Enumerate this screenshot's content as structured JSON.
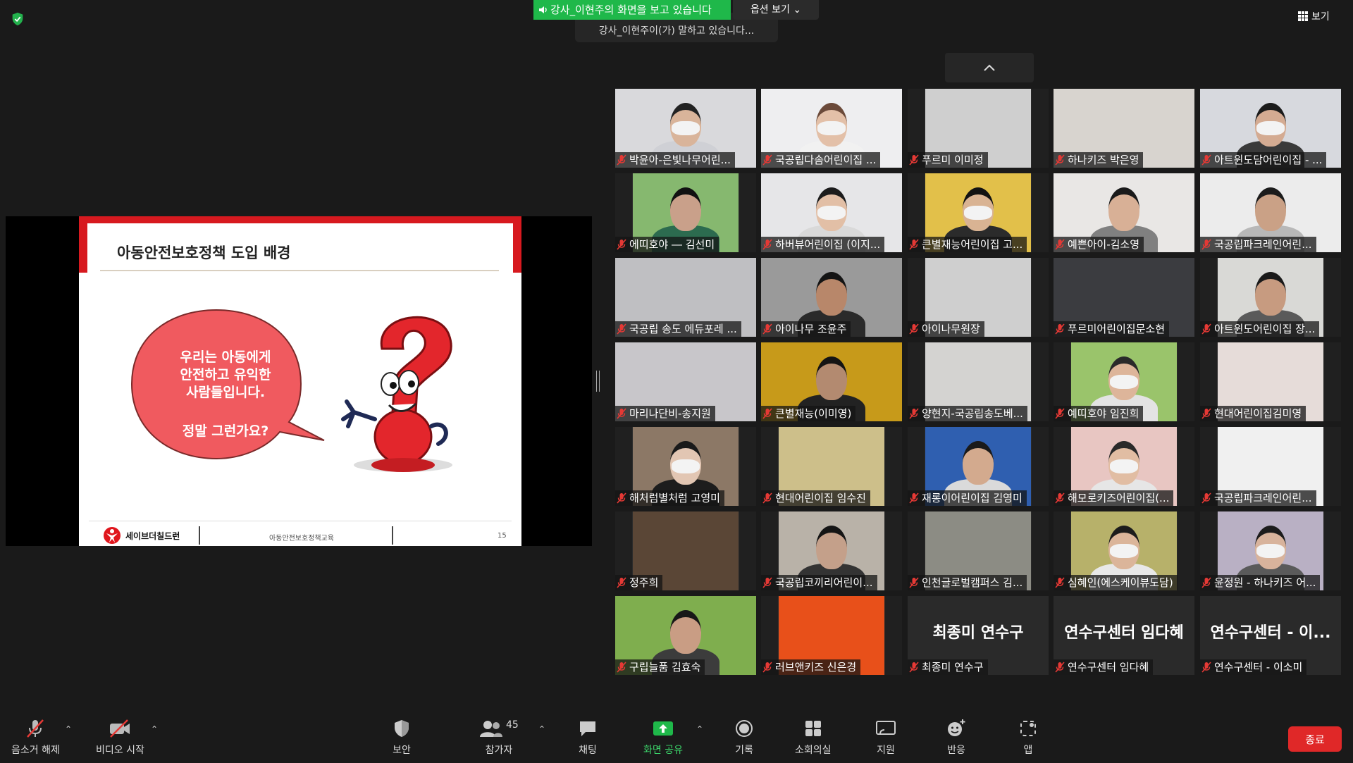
{
  "top": {
    "share_banner": "강사_이현주의 화면을 보고 있습니다",
    "view_options": "옵션 보기",
    "speaking": "강사_이현주이(가) 말하고 있습니다...",
    "view_label": "보기"
  },
  "slide": {
    "title": "아동안전보호정책 도입 배경",
    "bubble_lines": [
      "우리는 아동에게",
      "안전하고 유익한",
      "사람들입니다."
    ],
    "bubble_question": "정말 그런가요?",
    "footer_logo": "세이브더칠드런",
    "footer_center": "아동안전보호정책교육",
    "page_number": "15"
  },
  "participants": [
    {
      "name": "박윤아-은빛나무어린...",
      "video": true,
      "bg": "#d9d9dc",
      "skin": "#d9b49a",
      "hair": "#222",
      "shirt": "#cfd0d5",
      "mask": true
    },
    {
      "name": "국공립다솜어린이집 ...",
      "video": true,
      "bg": "#eeeef0",
      "skin": "#e3c0a8",
      "hair": "#6b4a3a",
      "shirt": "#f1f1f1",
      "mask": true
    },
    {
      "name": "푸르미 이미정",
      "video": true,
      "bg": "#cfcfcf",
      "skin": null,
      "hair": null,
      "shirt": null,
      "mask": false,
      "narrow": true
    },
    {
      "name": "하나키즈 박은영",
      "video": true,
      "bg": "#d8d4cf",
      "skin": null,
      "hair": null,
      "shirt": null,
      "mask": false
    },
    {
      "name": "아트윈도담어린이집 - ...",
      "video": true,
      "bg": "#d7d9de",
      "skin": "#d4ab92",
      "hair": "#1b1b1b",
      "shirt": "#3a3a3a",
      "mask": true
    },
    {
      "name": "에띠호야 ― 김선미",
      "video": true,
      "bg": "#86b86f",
      "skin": "#c9a08a",
      "hair": "#111",
      "shirt": "#2c6b4f",
      "mask": false,
      "narrow": true
    },
    {
      "name": "하버뷰어린이집 (이지...",
      "video": true,
      "bg": "#e6e6e8",
      "skin": "#e2bfa6",
      "hair": "#1c1c1c",
      "shirt": "#d9d9d9",
      "mask": true
    },
    {
      "name": "큰별재능어린이집 고...",
      "video": true,
      "bg": "#e2c04a",
      "skin": "#d9b393",
      "hair": "#121212",
      "shirt": "#2b2b2b",
      "mask": true,
      "narrow": true
    },
    {
      "name": "예쁜아이-김소영",
      "video": true,
      "bg": "#e9e7e5",
      "skin": "#d8b096",
      "hair": "#1a1a1a",
      "shirt": "#808080",
      "mask": false
    },
    {
      "name": "국공립파크레인어린...",
      "video": true,
      "bg": "#ececec",
      "skin": "#caa186",
      "hair": "#1c1c1c",
      "shirt": "#b8b8b8",
      "mask": false
    },
    {
      "name": "국공립 송도 에듀포레 ...",
      "video": true,
      "bg": "#bfbfc2",
      "skin": null,
      "hair": null,
      "shirt": null,
      "mask": false
    },
    {
      "name": "아이나무 조윤주",
      "video": true,
      "bg": "#9a9a9a",
      "skin": "#b8876a",
      "hair": "#141414",
      "shirt": "#2a2a2a",
      "mask": false
    },
    {
      "name": "아이나무원장",
      "video": true,
      "bg": "#cfcfcf",
      "skin": null,
      "hair": null,
      "shirt": null,
      "mask": false,
      "narrow": true
    },
    {
      "name": "푸르미어린이집문소현",
      "video": true,
      "bg": "#3b3c40",
      "skin": null,
      "hair": null,
      "shirt": null,
      "mask": false
    },
    {
      "name": "아트윈도어린이집 장...",
      "video": true,
      "bg": "#d9d9d6",
      "skin": "#c79b80",
      "hair": "#1a1a1a",
      "shirt": "#5a5a5a",
      "mask": false,
      "narrow": true
    },
    {
      "name": "마리나단비-송지원",
      "video": true,
      "bg": "#c8c6ca",
      "skin": null,
      "hair": null,
      "shirt": null,
      "mask": false
    },
    {
      "name": "큰별재능(이미영)",
      "video": true,
      "bg": "#c79a1a",
      "skin": "#b38a70",
      "hair": "#141414",
      "shirt": "#222",
      "mask": false
    },
    {
      "name": "양현지-국공립송도베...",
      "video": true,
      "bg": "#d4d3d1",
      "skin": null,
      "hair": null,
      "shirt": null,
      "mask": false,
      "narrow": true
    },
    {
      "name": "예띠호야 임진희",
      "video": true,
      "bg": "#9ac46b",
      "skin": "#ddb59a",
      "hair": "#2a2a2a",
      "shirt": "#e3e3e3",
      "mask": true,
      "narrow": true
    },
    {
      "name": "현대어린이집김미영",
      "video": true,
      "bg": "#e6dcd9",
      "skin": null,
      "hair": null,
      "shirt": null,
      "mask": false,
      "narrow": true
    },
    {
      "name": "해처럼별처럼 고영미",
      "video": true,
      "bg": "#8c7866",
      "skin": "#e2c6b3",
      "hair": "#1a1a1a",
      "shirt": "#1d1d1d",
      "mask": true,
      "narrow": true
    },
    {
      "name": "현대어린이집 임수진",
      "video": true,
      "bg": "#cdbf8a",
      "skin": null,
      "hair": null,
      "shirt": null,
      "mask": false,
      "narrow": true
    },
    {
      "name": "재롱이어린이집 김영미",
      "video": true,
      "bg": "#2f5fb0",
      "skin": "#d3aa8e",
      "hair": "#1a1a1a",
      "shirt": "#dadada",
      "mask": false,
      "narrow": true
    },
    {
      "name": "해모로키즈어린이집(...",
      "video": true,
      "bg": "#e8c6c2",
      "skin": "#e1bda3",
      "hair": "#2a2a2a",
      "shirt": "#e6e6e6",
      "mask": true,
      "narrow": true
    },
    {
      "name": "국공립파크레인어린...",
      "video": true,
      "bg": "#f0f0f0",
      "skin": null,
      "hair": null,
      "shirt": null,
      "mask": false,
      "narrow": true
    },
    {
      "name": "정주희",
      "video": true,
      "bg": "#5a4636",
      "skin": null,
      "hair": null,
      "shirt": null,
      "mask": false,
      "narrow": true
    },
    {
      "name": "국공립코끼리어린이...",
      "video": true,
      "bg": "#b9b2a8",
      "skin": "#c4a08a",
      "hair": "#151515",
      "shirt": "#333",
      "mask": false,
      "narrow": true
    },
    {
      "name": "인천글로벌캠퍼스 김...",
      "video": true,
      "bg": "#8c8c84",
      "skin": null,
      "hair": null,
      "shirt": null,
      "mask": false,
      "narrow": true
    },
    {
      "name": "심혜인(에스케이뷰도담)",
      "video": true,
      "bg": "#b7b16a",
      "skin": "#dbb59a",
      "hair": "#1c1c1c",
      "shirt": "#e8e8e8",
      "mask": true,
      "narrow": true
    },
    {
      "name": "윤정원 - 하나키즈 어...",
      "video": true,
      "bg": "#b9b0c4",
      "skin": "#d8b39c",
      "hair": "#1c1c1c",
      "shirt": "#5a5a5a",
      "mask": true,
      "narrow": true
    },
    {
      "name": "구립늘품 김효숙",
      "video": true,
      "bg": "#7fae4e",
      "skin": "#c99d84",
      "hair": "#181818",
      "shirt": "#3c3c3c",
      "mask": false
    },
    {
      "name": "러브앤키즈 신은경",
      "video": true,
      "bg": "#e8501a",
      "skin": null,
      "hair": null,
      "shirt": null,
      "mask": false,
      "narrow": true
    },
    {
      "name": "최종미 연수구",
      "video": false,
      "big": "최종미 연수구"
    },
    {
      "name": "연수구센터 임다혜",
      "video": false,
      "big": "연수구센터 임다혜"
    },
    {
      "name": "연수구센터 - 이소미",
      "video": false,
      "big": "연수구센터 - 이..."
    }
  ],
  "toolbar": {
    "mute_label": "음소거 해제",
    "video_label": "비디오 시작",
    "security_label": "보안",
    "participants_label": "참가자",
    "participants_count": "45",
    "chat_label": "채팅",
    "share_label": "화면 공유",
    "record_label": "기록",
    "breakout_label": "소회의실",
    "support_label": "지원",
    "reactions_label": "반응",
    "apps_label": "앱",
    "end_label": "종료"
  },
  "colors": {
    "background": "#1a1a1a",
    "share_green": "#1fb84a",
    "end_red": "#e02828",
    "muted_red": "#e53935",
    "slide_red": "#d7191f"
  }
}
